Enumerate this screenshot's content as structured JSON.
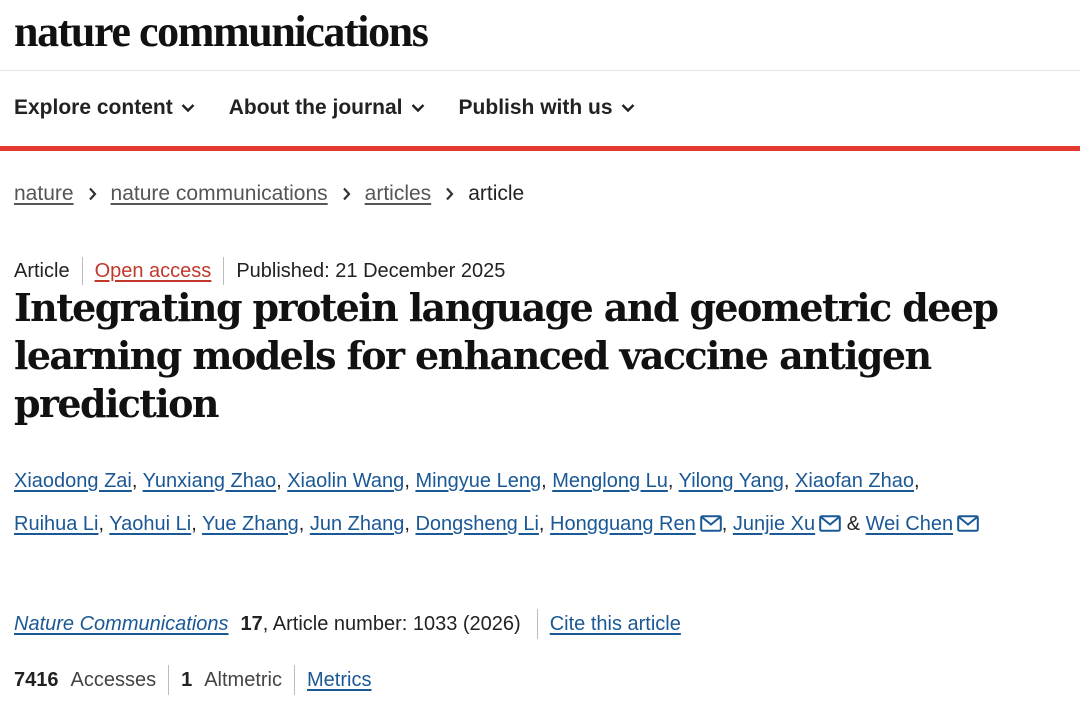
{
  "site": {
    "logo_text": "nature communications"
  },
  "nav": {
    "items": [
      {
        "label": "Explore content"
      },
      {
        "label": "About the journal"
      },
      {
        "label": "Publish with us"
      }
    ]
  },
  "breadcrumb": {
    "items": [
      "nature",
      "nature communications",
      "articles"
    ],
    "current": "article"
  },
  "article": {
    "type": "Article",
    "access": "Open access",
    "published": "Published: 21 December 2025",
    "title": "Integrating protein language and geometric deep learning models for enhanced vaccine antigen prediction",
    "authors": [
      "Xiaodong Zai",
      "Yunxiang Zhao",
      "Xiaolin Wang",
      "Mingyue Leng",
      "Menglong Lu",
      "Yilong Yang",
      "Xiaofan Zhao",
      "Ruihua Li",
      "Yaohui Li",
      "Yue Zhang",
      "Jun Zhang",
      "Dongsheng Li",
      "Hongguang Ren",
      "Junjie Xu",
      "Wei Chen"
    ],
    "and_symbol": "&"
  },
  "citation": {
    "journal": "Nature Communications",
    "volume": "17",
    "article_number": ", Article number: 1033 (2026)",
    "cite_link": "Cite this article"
  },
  "metrics": {
    "accesses_value": "7416",
    "accesses_label": "Accesses",
    "altmetric_value": "1",
    "altmetric_label": "Altmetric",
    "metrics_link": "Metrics"
  },
  "colors": {
    "accent_red": "#e53a2f",
    "link_blue": "#1a5896",
    "open_access": "#c0392b"
  }
}
